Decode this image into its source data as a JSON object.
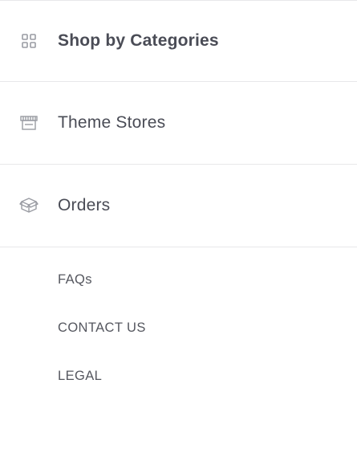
{
  "menu": {
    "items": [
      {
        "label": "Shop by Categories",
        "icon": "grid-icon"
      },
      {
        "label": "Theme Stores",
        "icon": "storefront-icon"
      },
      {
        "label": "Orders",
        "icon": "box-icon"
      }
    ]
  },
  "footer_links": {
    "faqs": "FAQs",
    "contact": "CONTACT US",
    "legal": "LEGAL"
  },
  "colors": {
    "text": "#4a4c56",
    "icon": "#9a9ca3",
    "divider": "#e8e8ea",
    "background": "#ffffff"
  }
}
